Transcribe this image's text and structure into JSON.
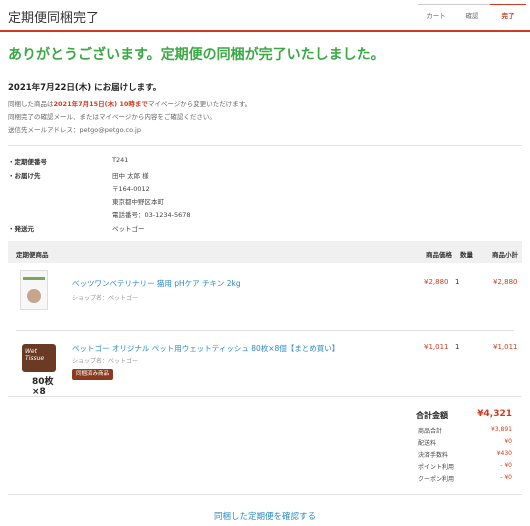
{
  "header": {
    "title": "定期便同梱完了",
    "steps": [
      "カート",
      "確認",
      "完了"
    ]
  },
  "thanks_message": "ありがとうございます。定期便の同梱が完了いたしました。",
  "delivery_date": "2021年7月22日(木) にお届けします。",
  "info": {
    "line1_prefix": "同梱した商品は",
    "line1_highlight": "2021年7月15日(木) 10時まで",
    "line1_suffix": "マイページから変更いただけます。",
    "line2": "同梱完了の確認メール、またはマイページから内容をご確認ください。",
    "line3": "送信先メールアドレス：petgo@petgo.co.jp"
  },
  "details": {
    "subscription_label": "・定期便番号",
    "subscription_value": "T241",
    "address_label": "・お届け先",
    "address_name": "田中 太郎 様",
    "address_zip": "〒164-0012",
    "address_city": "東京都中野区本町",
    "address_phone": "電話番号：03-1234-5678",
    "sender_label": "・発送元",
    "sender_value": "ペットゴー"
  },
  "table": {
    "headers": [
      "定期便商品",
      "商品価格",
      "数量",
      "商品小計"
    ]
  },
  "items": [
    {
      "name": "ベッツワンベテリナリー 猫用 pHケア チキン 2kg",
      "shop": "ショップ名：ペットゴー",
      "price": "¥2,880",
      "qty": "1",
      "subtotal": "¥2,880"
    },
    {
      "name": "ペットゴー オリジナル ペット用ウェットティッシュ 80枚×8個【まとめ買い】",
      "shop": "ショップ名：ペットゴー",
      "price": "¥1,011",
      "qty": "1",
      "subtotal": "¥1,011",
      "tag": "同梱済み商品",
      "image_pack_text": "Wet Tissue",
      "image_qty_text": "80枚×8"
    }
  ],
  "summary": {
    "title": "合計金額",
    "total": "¥4,321",
    "rows": [
      {
        "label": "商品合計",
        "value": "¥3,891"
      },
      {
        "label": "配送料",
        "value": "¥0"
      },
      {
        "label": "決済手数料",
        "value": "¥430"
      },
      {
        "label": "ポイント利用",
        "value": "- ¥0"
      },
      {
        "label": "クーポン利用",
        "value": "- ¥0"
      }
    ]
  },
  "confirm_link": "同梱した定期便を確認する",
  "colors": {
    "accent": "#d03b1f",
    "success": "#3aa845",
    "link": "#2a8ac8"
  }
}
